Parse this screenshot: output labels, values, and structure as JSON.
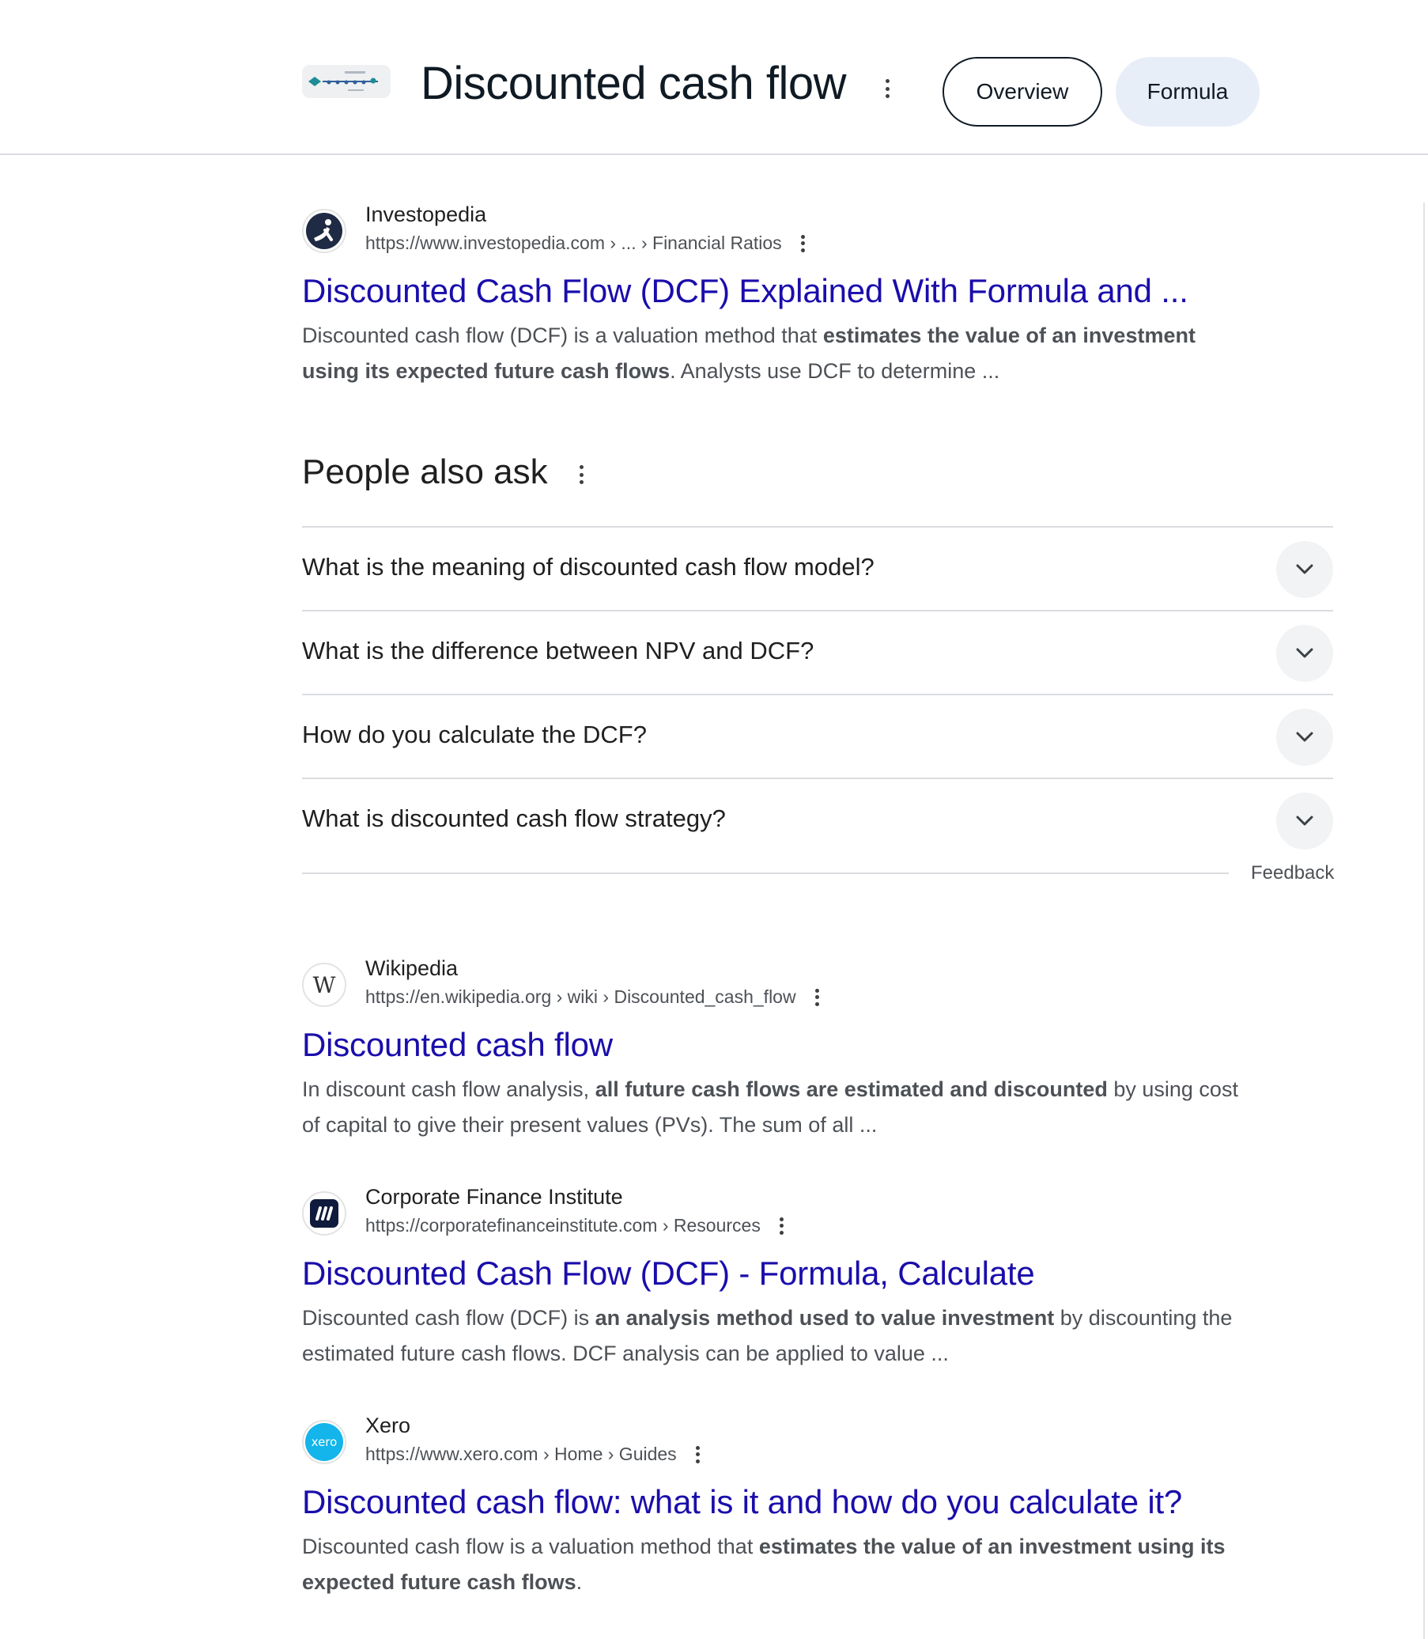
{
  "header": {
    "title": "Discounted cash flow",
    "chips": {
      "overview": "Overview",
      "formula": "Formula"
    }
  },
  "results": [
    {
      "site": "Investopedia",
      "url": "https://www.investopedia.com › ... › Financial Ratios",
      "title": "Discounted Cash Flow (DCF) Explained With Formula and ...",
      "snippet": [
        {
          "t": "Discounted cash flow (DCF) is a valuation method that ",
          "b": false
        },
        {
          "t": "estimates the value of an investment using its expected future cash flows",
          "b": true
        },
        {
          "t": ". Analysts use DCF to determine ...",
          "b": false
        }
      ]
    },
    {
      "site": "Wikipedia",
      "url": "https://en.wikipedia.org › wiki › Discounted_cash_flow",
      "title": "Discounted cash flow",
      "snippet": [
        {
          "t": "In discount cash flow analysis, ",
          "b": false
        },
        {
          "t": "all future cash flows are estimated and discounted",
          "b": true
        },
        {
          "t": " by using cost of capital to give their present values (PVs). The sum of all ...",
          "b": false
        }
      ]
    },
    {
      "site": "Corporate Finance Institute",
      "url": "https://corporatefinanceinstitute.com › Resources",
      "title": "Discounted Cash Flow (DCF) - Formula, Calculate",
      "snippet": [
        {
          "t": "Discounted cash flow (DCF) is ",
          "b": false
        },
        {
          "t": "an analysis method used to value investment",
          "b": true
        },
        {
          "t": " by discounting the estimated future cash flows. DCF analysis can be applied to value ...",
          "b": false
        }
      ]
    },
    {
      "site": "Xero",
      "url": "https://www.xero.com › Home › Guides",
      "title": "Discounted cash flow: what is it and how do you calculate it?",
      "snippet": [
        {
          "t": "Discounted cash flow is a valuation method that ",
          "b": false
        },
        {
          "t": "estimates the value of an investment using its expected future cash flows",
          "b": true
        },
        {
          "t": ".",
          "b": false
        }
      ]
    }
  ],
  "favicons": {
    "investopedia": "i",
    "wikipedia": "W",
    "xero": "xero"
  },
  "paa": {
    "title": "People also ask",
    "questions": [
      "What is the meaning of discounted cash flow model?",
      "What is the difference between NPV and DCF?",
      "How do you calculate the DCF?",
      "What is discounted cash flow strategy?"
    ],
    "feedback": "Feedback"
  },
  "colors": {
    "link": "#1a0dab",
    "snippet": "#4d5156",
    "divider": "#dadce0",
    "chip_fill": "#e8eef8"
  }
}
